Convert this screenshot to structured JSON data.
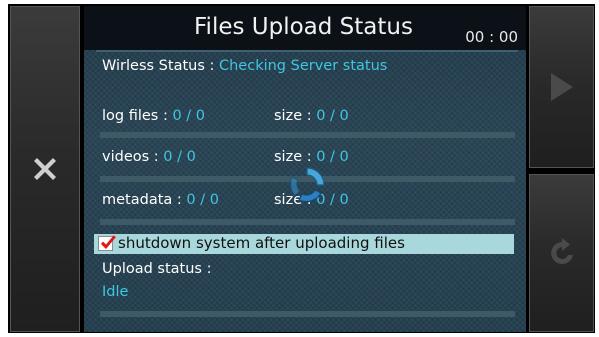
{
  "header": {
    "title": "Files Upload Status",
    "clock": "00 : 00"
  },
  "wireless": {
    "label": "Wirless Status : ",
    "value": "Checking Server status"
  },
  "rows": [
    {
      "label": "log files : ",
      "count": "0 / 0",
      "size_label": "size : ",
      "size": "0 / 0"
    },
    {
      "label": "videos : ",
      "count": "0 / 0",
      "size_label": "size : ",
      "size": "0 / 0"
    },
    {
      "label": "metadata : ",
      "count": "0 / 0",
      "size_label": "size : ",
      "size": "0 / 0"
    }
  ],
  "shutdown_option": {
    "label": "shutdown system after uploading files",
    "checked": true
  },
  "upload": {
    "label": "Upload status :",
    "value": "Idle"
  },
  "icons": {
    "close": "close-x-icon",
    "play": "play-icon",
    "reload": "reload-icon",
    "spinner": "loading-spinner-icon",
    "check": "checkmark-icon"
  },
  "colors": {
    "accent": "#3fc6e0",
    "check": "#e01818",
    "highlight_row": "#a8d8dc"
  }
}
